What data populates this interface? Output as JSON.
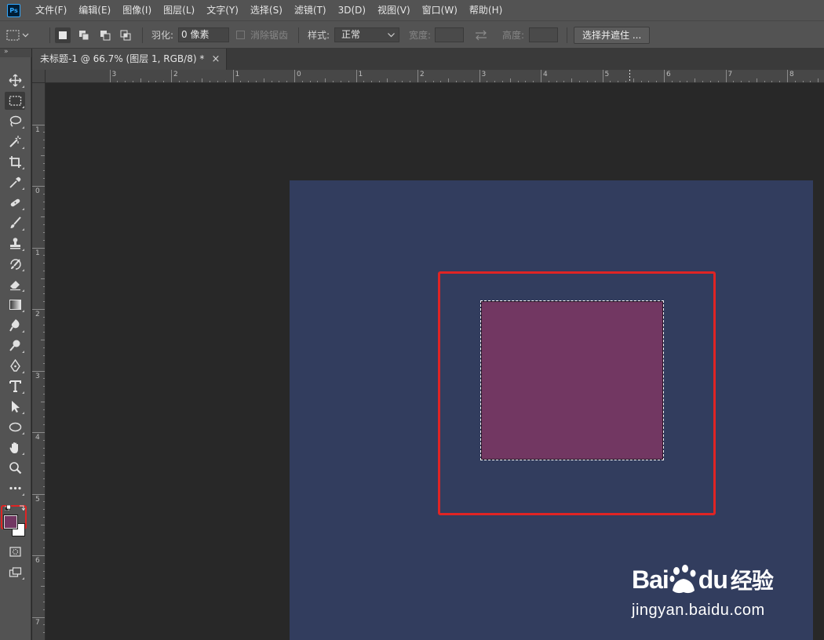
{
  "app": {
    "logo_text": "Ps"
  },
  "menu": [
    "文件(F)",
    "编辑(E)",
    "图像(I)",
    "图层(L)",
    "文字(Y)",
    "选择(S)",
    "滤镜(T)",
    "3D(D)",
    "视图(V)",
    "窗口(W)",
    "帮助(H)"
  ],
  "options": {
    "feather_label": "羽化:",
    "feather_value": "0 像素",
    "antialias_label": "消除锯齿",
    "style_label": "样式:",
    "style_value": "正常",
    "width_label": "宽度:",
    "height_label": "高度:",
    "select_mask_button": "选择并遮住 ..."
  },
  "document_tab": {
    "title": "未标题-1 @ 66.7% (图层 1, RGB/8) *",
    "close": "×"
  },
  "ruler": {
    "top_labels": [
      "3",
      "2",
      "1",
      "0",
      "1",
      "2",
      "3",
      "4",
      "5",
      "6",
      "7",
      "8"
    ],
    "left_labels": [
      "1",
      "0",
      "1",
      "2",
      "3",
      "4",
      "5",
      "6",
      "7"
    ]
  },
  "colors": {
    "document_bg": "#323d5e",
    "purple_fill": "#723762",
    "foreground_color": "#723762",
    "background_color": "#ffffff",
    "highlight": "#e02424"
  },
  "tools": [
    "move-icon",
    "rect-marquee-icon",
    "lasso-icon",
    "magic-wand-icon",
    "crop-icon",
    "eyedropper-icon",
    "healing-brush-icon",
    "brush-icon",
    "clone-stamp-icon",
    "history-brush-icon",
    "eraser-icon",
    "gradient-icon",
    "blur-icon",
    "dodge-icon",
    "pen-icon",
    "type-icon",
    "path-selection-icon",
    "ellipse-icon",
    "hand-icon",
    "zoom-icon",
    "more-tools-icon",
    "quick-mask-icon",
    "screen-mode-icon"
  ],
  "watermark": {
    "logo_text_left": "Bai",
    "logo_text_right": "du",
    "logo_text_cn": "经验",
    "url": "jingyan.baidu.com"
  }
}
